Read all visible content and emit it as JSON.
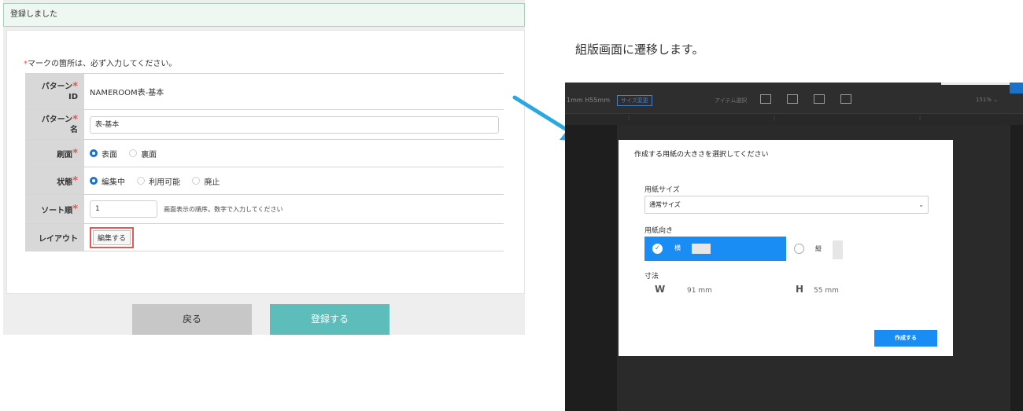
{
  "form": {
    "success_message": "登録しました",
    "required_marker": "*",
    "required_note": "マークの箇所は、必ず入力してください。",
    "fields": {
      "pattern_id": {
        "label_line1": "パターン",
        "label_line2": "ID",
        "value": "NAMEROOM表-基本"
      },
      "pattern_name": {
        "label_line1": "パターン",
        "label_line2": "名",
        "value": "表-基本"
      },
      "print_side": {
        "label": "刷面",
        "options": [
          "表面",
          "裏面"
        ],
        "selected": "表面"
      },
      "state": {
        "label": "状態",
        "options": [
          "編集中",
          "利用可能",
          "廃止"
        ],
        "selected": "編集中"
      },
      "sort_order": {
        "label": "ソート順",
        "value": "1",
        "hint": "画面表示の順序。数字で入力してください"
      },
      "layout": {
        "label": "レイアウト",
        "button_label": "編集する"
      }
    },
    "back_button": "戻る",
    "register_button": "登録する"
  },
  "caption": "組版画面に遷移します。",
  "editor": {
    "size_text": "1mm H55mm",
    "size_change_button": "サイズ変更",
    "item_select": "アイテム選択",
    "zoom": "151%  ⌄",
    "modal": {
      "title": "作成する用紙の大きさを選択してください",
      "paper_size_label": "用紙サイズ",
      "paper_size_value": "通常サイズ",
      "orientation_label": "用紙向き",
      "orientation_landscape": "横",
      "orientation_portrait": "縦",
      "orientation_selected": "横",
      "dimensions_label": "寸法",
      "width_label": "W",
      "width_value": "91 mm",
      "height_label": "H",
      "height_value": "55 mm",
      "create_button": "作成する"
    }
  },
  "colors": {
    "required": "#e05555",
    "primary_blue": "#1a8df5",
    "register_teal": "#5dbdba",
    "highlight_red": "#e05a5a",
    "arrow": "#2ba8e0"
  }
}
